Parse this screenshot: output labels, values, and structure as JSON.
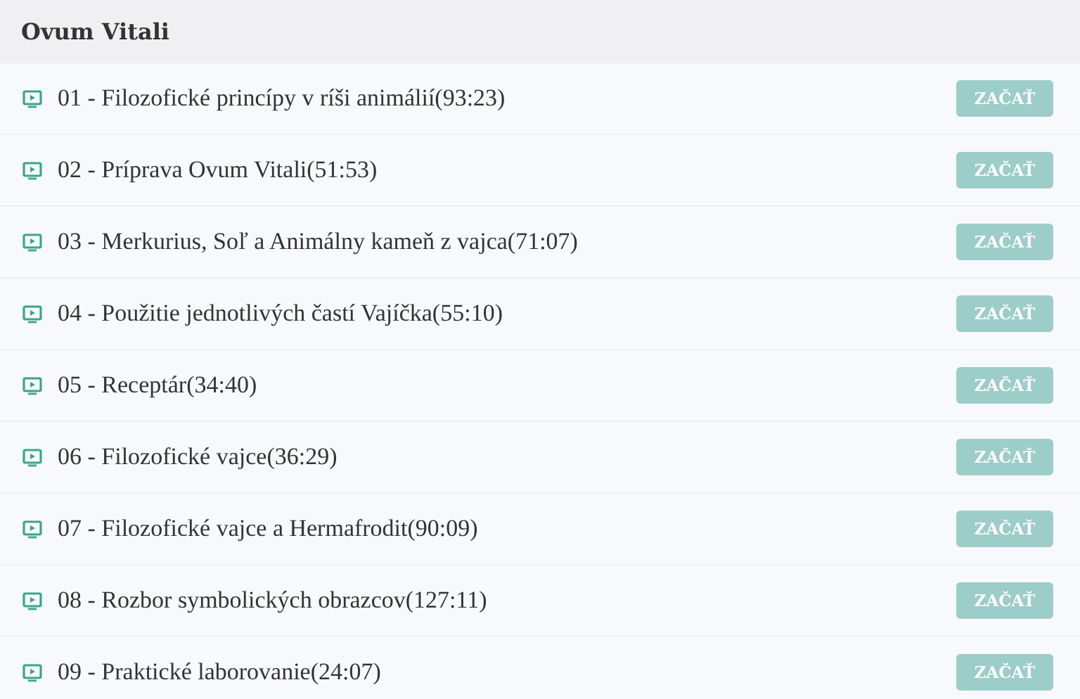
{
  "title": "Ovum Vitali",
  "lessons": [
    {
      "label": "01 - Filozofické princípy v ríši animálií(93:23)",
      "button": "ZAČAŤ"
    },
    {
      "label": "02 - Príprava Ovum Vitali(51:53)",
      "button": "ZAČAŤ"
    },
    {
      "label": "03 - Merkurius, Soľ a Animálny kameň z vajca(71:07)",
      "button": "ZAČAŤ"
    },
    {
      "label": "04 - Použitie jednotlivých častí Vajíčka(55:10)",
      "button": "ZAČAŤ"
    },
    {
      "label": "05 - Receptár(34:40)",
      "button": "ZAČAŤ"
    },
    {
      "label": "06 - Filozofické vajce(36:29)",
      "button": "ZAČAŤ"
    },
    {
      "label": "07 - Filozofické vajce a Hermafrodit(90:09)",
      "button": "ZAČAŤ"
    },
    {
      "label": "08 - Rozbor symbolických obrazcov(127:11)",
      "button": "ZAČAŤ"
    },
    {
      "label": "09 - Praktické laborovanie(24:07)",
      "button": "ZAČAŤ"
    }
  ]
}
